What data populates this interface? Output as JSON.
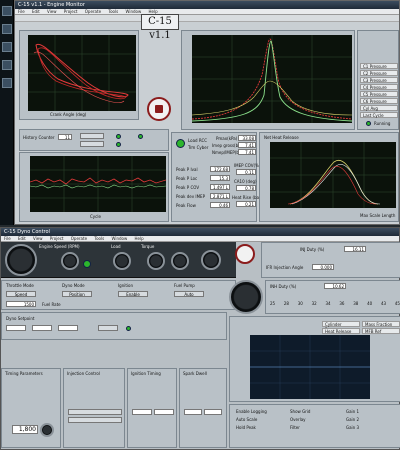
{
  "top_window": {
    "title": "C-15 v1.1 - Engine Monitor",
    "menu": [
      "File",
      "Edit",
      "View",
      "Project",
      "Operate",
      "Tools",
      "Window",
      "Help"
    ],
    "app_title": "C-15 v1.1",
    "tabs_left": [
      "Pressure",
      "Heat Release",
      "MFB"
    ],
    "tabs_right": [
      "Cyl Pressure Trace",
      "Heat Release Rate",
      "MFB Comparison"
    ],
    "crank_label": "Crank Angle (deg)",
    "load_label": "Load RCC",
    "load_button": "Trm Cyber",
    "history_label": "History Counter",
    "history_value": "11",
    "small_tabs": [
      "Cycle",
      "Stats",
      "Combustion",
      "Knock"
    ],
    "stats": [
      {
        "label": "Pmax(kPa)",
        "value": "33.08"
      },
      {
        "label": "Imep gross(bar)",
        "value": "7.41"
      },
      {
        "label": "Nmep/IMEP(bar)",
        "value": "7.41"
      }
    ],
    "peak_stats": [
      {
        "label": "Peak P Ival",
        "value": "172.68"
      },
      {
        "label": "Peak P Loc",
        "value": "15.3"
      },
      {
        "label": "Peak P COV",
        "value": "1.497 L"
      },
      {
        "label": "Peak dev IMEP",
        "value": "2.871 L"
      },
      {
        "label": "Peak Flow",
        "value": "0.46"
      }
    ],
    "right_stats": [
      {
        "label": "IMEP COV(%)",
        "value": "0.11"
      },
      {
        "label": "CA10 (deg)",
        "value": "0.78"
      },
      {
        "label": "Heat Rise (bar)",
        "value": "0.21"
      }
    ],
    "legend_items": [
      "C1 Pressure",
      "C2 Pressure",
      "C3 Pressure",
      "C4 Pressure",
      "C5 Pressure",
      "C6 Pressure",
      "Cyl Avg",
      "Last Cycle"
    ],
    "running_label": "Running",
    "heat_plot_title": "Net Heat Release",
    "scale_label": "Max Scale Length",
    "xlabel_bottom": "Cycle"
  },
  "bottom_window": {
    "title": "C-15 Dyno Control",
    "menu": [
      "File",
      "Edit",
      "View",
      "Project",
      "Operate",
      "Tools",
      "Window",
      "Help"
    ],
    "gauge_labels": [
      "Engine Speed (RPM)",
      "Load",
      "Torque"
    ],
    "toggle_labels": [
      "Throttle Mode",
      "Dyno Mode",
      "Ignition",
      "Fuel Pump"
    ],
    "toggle_sub": [
      "Speed",
      "Position",
      "Enable",
      "Auto"
    ],
    "fuel_label": "Fuel Rate",
    "inj_duty_label": "INJ Duty (%)",
    "inj_duty_value": "16.11",
    "ma_duty_label": "INH Duty (%)",
    "ma_duty_value": "10.62",
    "duty_scale": [
      "25",
      "28",
      "30",
      "32",
      "34",
      "36",
      "38",
      "40",
      "43",
      "45"
    ],
    "afr_label": "IFR Injection Angle",
    "afr_value": "0.000",
    "rpm_value": "1500",
    "dyno_label": "Dyno Setpoint",
    "value_1800": "1,800",
    "section_labels": [
      "Timing Parameters",
      "Injection Control",
      "Ignition Timing",
      "Spark Dwell"
    ],
    "right_plot_legend": [
      "Cylinder Pressure",
      "Heat Release",
      "Mass Fraction",
      "MFB Ref"
    ],
    "bottom_checks": [
      "Enable Logging",
      "Auto Scale",
      "Hold Peak",
      "Show Grid",
      "Overlay",
      "Filter"
    ],
    "knob_labels": [
      "Gain 1",
      "Gain 2",
      "Gain 3"
    ]
  },
  "colors": {
    "plot_bg": "#0b120b",
    "trace_red": "#e23a3a",
    "trace_green": "#8be08b",
    "trace_yellow": "#d9d36a",
    "led_green": "#2cb52c"
  }
}
